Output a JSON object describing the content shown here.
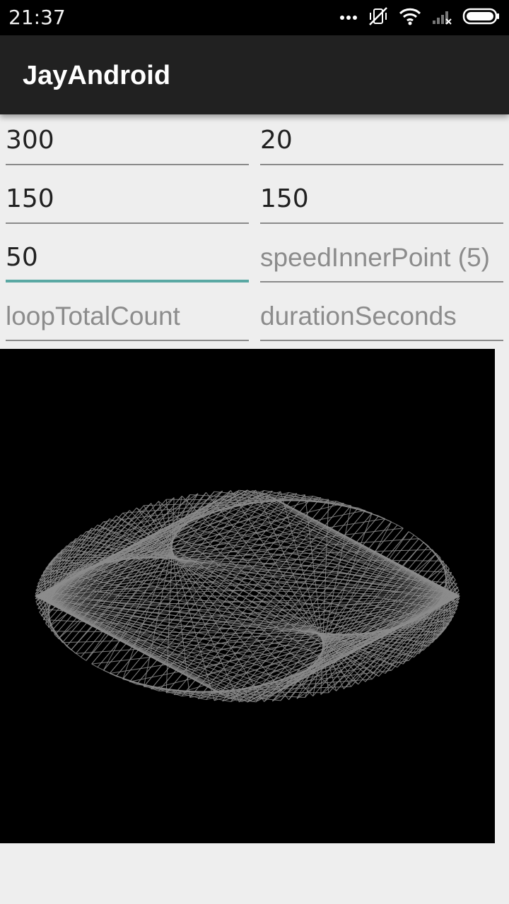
{
  "status_bar": {
    "time": "21:37",
    "icons": [
      "more-dots-icon",
      "vibrate-off-icon",
      "wifi-icon",
      "cell-signal-icon",
      "battery-icon"
    ]
  },
  "app_bar": {
    "title": "JayAndroid"
  },
  "fields": [
    {
      "value": "300",
      "placeholder": ""
    },
    {
      "value": "20",
      "placeholder": ""
    },
    {
      "value": "150",
      "placeholder": ""
    },
    {
      "value": "150",
      "placeholder": ""
    },
    {
      "value": "50",
      "placeholder": "",
      "focused": true
    },
    {
      "value": "",
      "placeholder": "speedInnerPoint (5)"
    },
    {
      "value": "",
      "placeholder": "loopTotalCount"
    },
    {
      "value": "",
      "placeholder": "durationSeconds"
    }
  ],
  "drawing": {
    "background": "#000000",
    "line_color": "#8c8c8c"
  },
  "colors": {
    "status_bar": "#000000",
    "app_bar": "#212121",
    "accent": "#5aa8a3",
    "page_background": "#eeeeee"
  }
}
